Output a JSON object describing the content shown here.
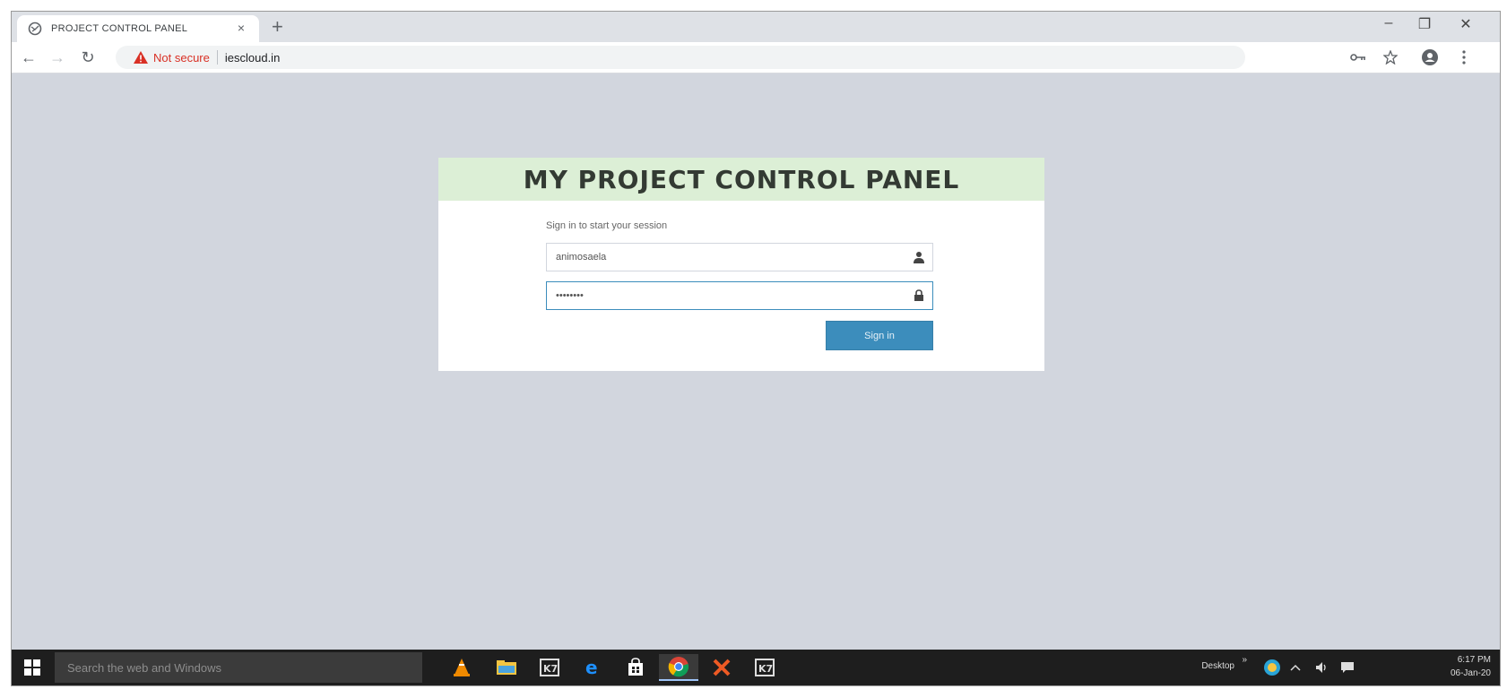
{
  "browser": {
    "tab": {
      "title": "PROJECT CONTROL PANEL",
      "close": "×"
    },
    "new_tab": "+",
    "window_controls": {
      "minimize": "–",
      "maximize": "❐",
      "close": "✕"
    },
    "toolbar": {
      "back": "←",
      "forward": "→",
      "reload": "↻",
      "security_label": "Not secure",
      "url": "iescloud.in",
      "icons": [
        "key-icon",
        "star-icon",
        "profile-icon",
        "menu-icon"
      ]
    }
  },
  "login": {
    "title": "MY PROJECT CONTROL PANEL",
    "message": "Sign in to start your session",
    "username": {
      "value": "animosaela"
    },
    "password": {
      "value": "••••••••"
    },
    "submit_label": "Sign in"
  },
  "taskbar": {
    "search_placeholder": "Search the web and Windows",
    "apps": [
      "vlc-icon",
      "file-explorer-icon",
      "k7-icon",
      "edge-icon",
      "store-icon",
      "chrome-icon",
      "close-app-icon",
      "k7-icon"
    ],
    "tray": {
      "desktop_label": "Desktop",
      "chevron": "»",
      "time": "6:17 PM",
      "date": "06-Jan-20"
    }
  },
  "colors": {
    "page_bg": "#d2d6de",
    "header_bg": "#dcefd6",
    "primary": "#3c8dbc",
    "taskbar_bg": "#1e1e1e",
    "warning": "#d93025"
  }
}
